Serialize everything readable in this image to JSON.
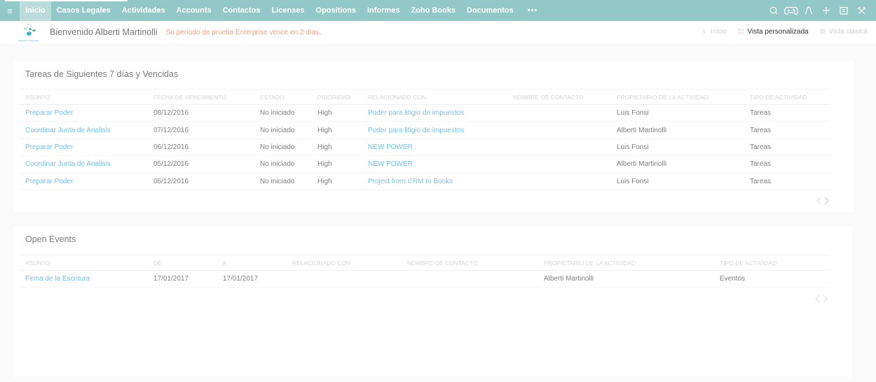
{
  "nav": {
    "menu_icon": "hamburger-icon",
    "items": [
      {
        "label": "Inicio",
        "active": true
      },
      {
        "label": "Casos Legales"
      },
      {
        "label": "Actividades"
      },
      {
        "label": "Accounts"
      },
      {
        "label": "Contactos"
      },
      {
        "label": "Licenses"
      },
      {
        "label": "Opositions"
      },
      {
        "label": "Informes"
      },
      {
        "label": "Zoho Books"
      },
      {
        "label": "Documentos"
      },
      {
        "label": "•••"
      }
    ],
    "right_icons": [
      "search-icon",
      "gamepad-icon",
      "signal-icon",
      "plus-icon",
      "calendar-icon",
      "tools-icon"
    ],
    "accent_color": "#92c8c7"
  },
  "welcome": {
    "logo_caption": "Martinolli & Associates",
    "greeting": "Bienvenido Alberti Martinolli",
    "trial_notice": "Su período de prueba Enterprise vence en 2 días.",
    "trial_color": "#f2a283",
    "views": [
      {
        "label": "Inicio",
        "icon": "lightning-icon"
      },
      {
        "label": "Vista personalizada",
        "icon": "grid-icon",
        "active": true
      },
      {
        "label": "Vista clásica",
        "icon": "square-icon"
      }
    ]
  },
  "tasks": {
    "title": "Tareas de Siguientes 7 días y Vencidas",
    "columns": [
      "ASUNTO",
      "FECHA DE VENCIMIENTO",
      "ESTADO",
      "PRIORIDAD",
      "RELACIONADO CON",
      "NOMBRE DE CONTACTO",
      "PROPIETARIO DE LA ACTIVIDAD",
      "TIPO DE ACTIVIDAD"
    ],
    "rows": [
      [
        "Preparar Poder",
        "08/12/2016",
        "No iniciado",
        "High",
        "Poder para litigio de impuestos",
        "",
        "Luis Fonsi",
        "Tareas"
      ],
      [
        "Coordinar Junta de Analisis",
        "07/12/2016",
        "No iniciado",
        "High",
        "Poder para litigio de impuestos",
        "",
        "Alberti Martinolli",
        "Tareas"
      ],
      [
        "Preparar Poder",
        "06/12/2016",
        "No iniciado",
        "High",
        "NEW POWER",
        "",
        "Luis Fonsi",
        "Tareas"
      ],
      [
        "Coordinar Junta de Analisis",
        "05/12/2016",
        "No iniciado",
        "High",
        "NEW POWER",
        "",
        "Alberti Martinolli",
        "Tareas"
      ],
      [
        "Preparar Poder",
        "06/12/2016",
        "No iniciado",
        "High",
        "Project from CRM to Books",
        "",
        "Luis Fonsi",
        "Tareas"
      ]
    ]
  },
  "events": {
    "title": "Open Events",
    "columns": [
      "ASUNTO",
      "DE",
      "A",
      "RELACIONADO CON",
      "NOMBRE DE CONTACTO",
      "PROPIETARIO DE LA ACTIVIDAD",
      "TIPO DE ACTIVIDAD"
    ],
    "rows": [
      [
        "Firma de la Escritura",
        "17/01/2017",
        "17/01/2017",
        "",
        "",
        "Alberti Martinolli",
        "Eventos"
      ]
    ]
  }
}
